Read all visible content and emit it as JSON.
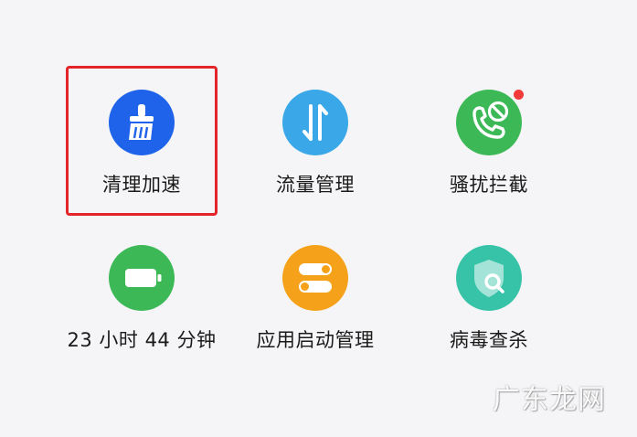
{
  "colors": {
    "background": "#f5f5f7",
    "highlight_border": "#e3252b",
    "badge": "#f23a3a",
    "label_text": "#1a1a1a"
  },
  "tiles": [
    {
      "id": "clean-speedup",
      "label": "清理加速",
      "icon": "broom-icon",
      "color": "#1e63e9",
      "highlighted": true,
      "badge": false
    },
    {
      "id": "data-management",
      "label": "流量管理",
      "icon": "data-arrows-icon",
      "color": "#3aa8e8",
      "highlighted": false,
      "badge": false
    },
    {
      "id": "harassment-block",
      "label": "骚扰拦截",
      "icon": "phone-block-icon",
      "color": "#3cb956",
      "highlighted": false,
      "badge": true
    },
    {
      "id": "battery",
      "label": "23 小时 44 分钟",
      "icon": "battery-icon",
      "color": "#3cb956",
      "highlighted": false,
      "badge": false
    },
    {
      "id": "startup-management",
      "label": "应用启动管理",
      "icon": "toggle-switch-icon",
      "color": "#f5a21a",
      "highlighted": false,
      "badge": false
    },
    {
      "id": "virus-scan",
      "label": "病毒查杀",
      "icon": "shield-search-icon",
      "color": "#37c3a8",
      "highlighted": false,
      "badge": false
    }
  ],
  "watermark": "广东龙网"
}
